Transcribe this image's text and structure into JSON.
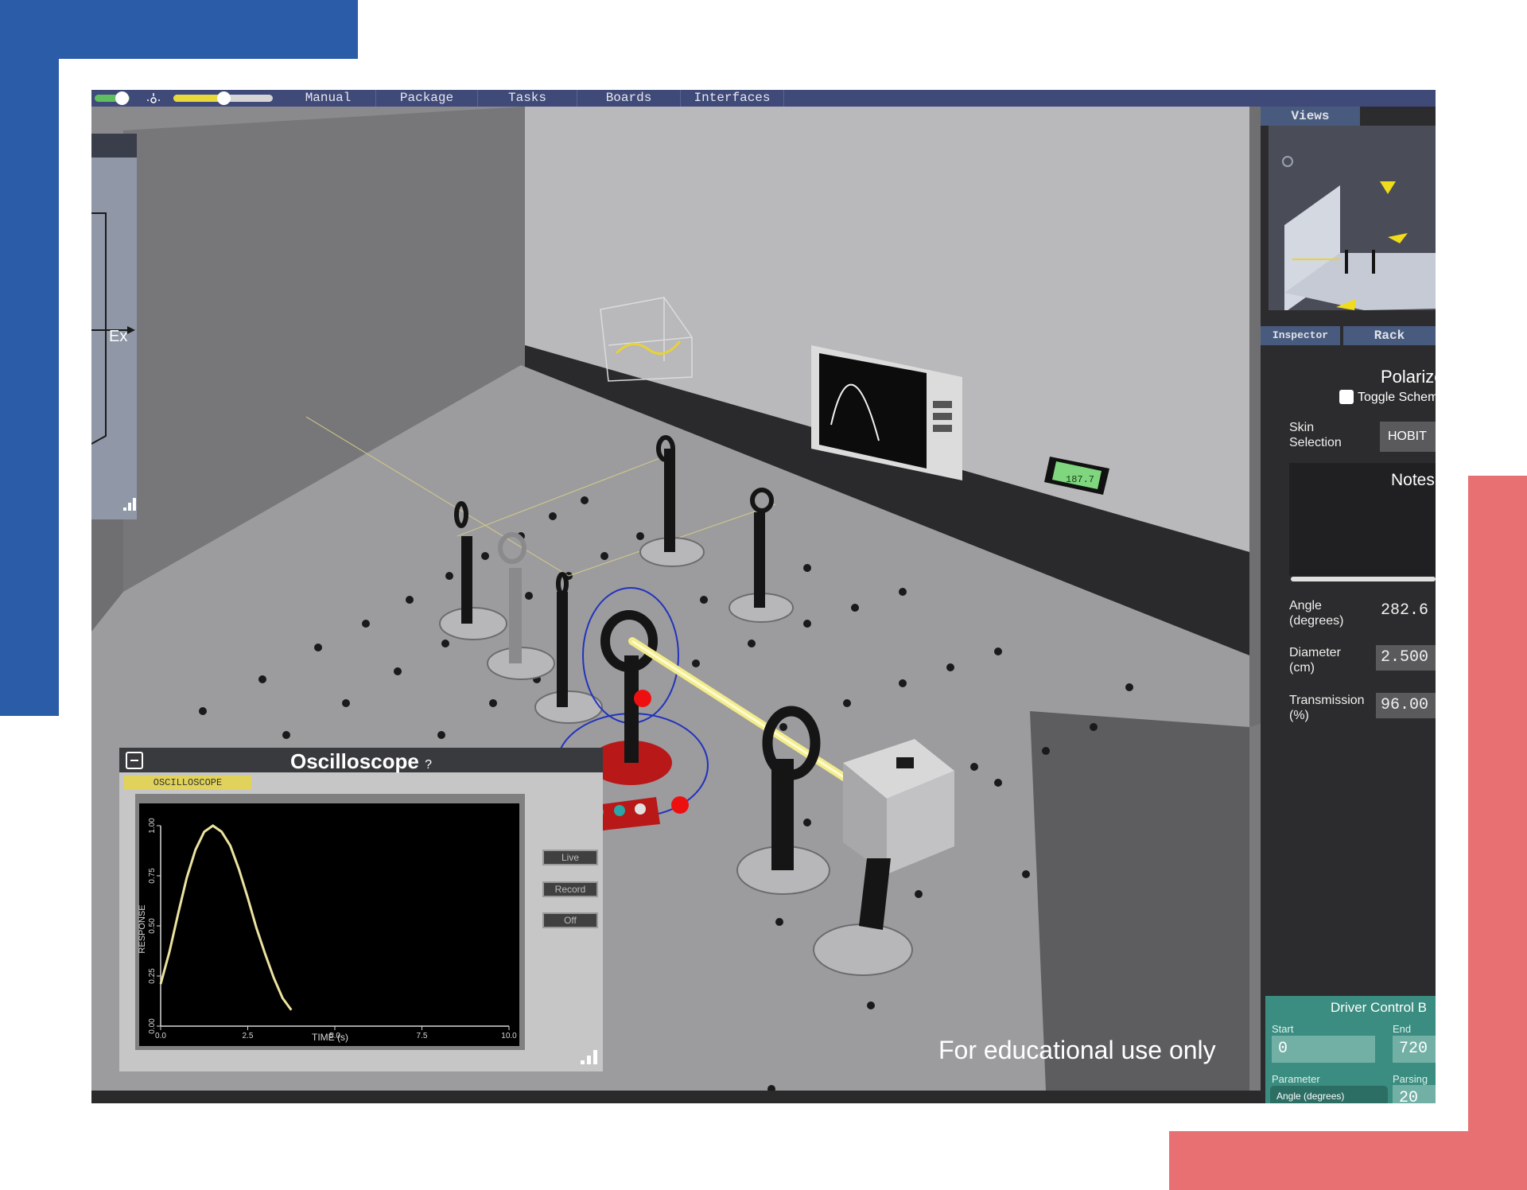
{
  "menubar": {
    "items": [
      "Manual",
      "Package",
      "Tasks",
      "Boards",
      "Interfaces"
    ]
  },
  "left_panel": {
    "axis_label": "Ex"
  },
  "sidebar": {
    "tabs": {
      "views": "Views",
      "inspector": "Inspector",
      "rack": "Rack"
    },
    "inspector": {
      "component_title": "Polarize",
      "toggle_label": "Toggle Schem",
      "skin_label": "Skin Selection",
      "skin_value": "HOBIT",
      "notes_title": "Notes",
      "fields": [
        {
          "label": "Angle (degrees)",
          "value": "282.6"
        },
        {
          "label": "Diameter (cm)",
          "value": "2.500"
        },
        {
          "label": "Transmission (%)",
          "value": "96.00"
        }
      ]
    },
    "driver": {
      "title": "Driver Control B",
      "start_label": "Start",
      "start_value": "0",
      "end_label": "End",
      "end_value": "720",
      "parameter_label": "Parameter",
      "parameter_value": "Angle (degrees)",
      "parsing_label": "Parsing",
      "parsing_value": "20"
    }
  },
  "oscilloscope": {
    "title": "Oscilloscope",
    "help": "?",
    "badge": "OSCILLOSCOPE",
    "buttons": [
      "Live",
      "Record",
      "Off"
    ]
  },
  "wall_display": {
    "meter_reading": "187.7"
  },
  "watermark": "For educational use only",
  "colors": {
    "menubar": "#3f4a78",
    "beam": "#ece36a",
    "selected_mount": "#b81818",
    "driver_panel": "#3a8d80",
    "deco_blue": "#2b5ca8",
    "deco_pink": "#e87072"
  },
  "chart_data": {
    "type": "line",
    "title": "",
    "xlabel": "TIME (s)",
    "ylabel": "RESPONSE",
    "xlim": [
      0,
      10
    ],
    "ylim": [
      0,
      1
    ],
    "xticks": [
      "0.0",
      "2.5",
      "5.0",
      "7.5",
      "10.0"
    ],
    "yticks": [
      "0.00",
      "0.25",
      "0.50",
      "0.75",
      "1.00"
    ],
    "grid": false,
    "series": [
      {
        "x": [
          0.0,
          0.25,
          0.5,
          0.75,
          1.0,
          1.25,
          1.5,
          1.75,
          2.0,
          2.25,
          2.5,
          2.75,
          3.0,
          3.25,
          3.5,
          3.75
        ],
        "values": [
          0.21,
          0.37,
          0.56,
          0.74,
          0.88,
          0.97,
          1.0,
          0.97,
          0.9,
          0.78,
          0.64,
          0.49,
          0.36,
          0.24,
          0.14,
          0.08
        ]
      }
    ]
  }
}
